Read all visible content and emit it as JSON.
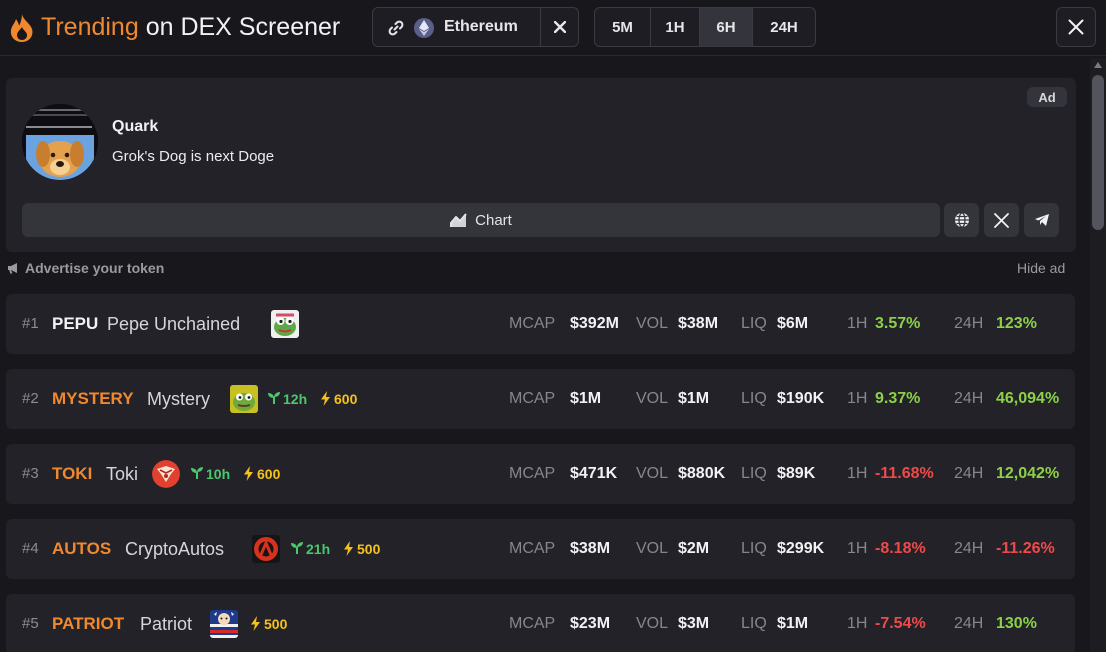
{
  "header": {
    "title_accent": "Trending",
    "title_rest": "on DEX Screener",
    "chain_name": "Ethereum",
    "timeframes": [
      "5M",
      "1H",
      "6H",
      "24H"
    ],
    "active_timeframe": "6H"
  },
  "ad": {
    "name": "Quark",
    "description": "Grok's Dog is next Doge",
    "badge": "Ad",
    "chart_label": "Chart",
    "advertise_label": "Advertise your token",
    "hide_label": "Hide ad"
  },
  "labels": {
    "mcap": "MCAP",
    "vol": "VOL",
    "liq": "LIQ",
    "h1": "1H",
    "h24": "24H"
  },
  "tokens": [
    {
      "rank": "#1",
      "symbol": "PEPU",
      "name": "Pepe Unchained",
      "age": "",
      "boost": "",
      "mcap": "$392M",
      "vol": "$38M",
      "liq": "$6M",
      "h1": "3.57%",
      "h24": "123%"
    },
    {
      "rank": "#2",
      "symbol": "MYSTERY",
      "name": "Mystery",
      "age": "12h",
      "boost": "600",
      "mcap": "$1M",
      "vol": "$1M",
      "liq": "$190K",
      "h1": "9.37%",
      "h24": "46,094%"
    },
    {
      "rank": "#3",
      "symbol": "TOKI",
      "name": "Toki",
      "age": "10h",
      "boost": "600",
      "mcap": "$471K",
      "vol": "$880K",
      "liq": "$89K",
      "h1": "-11.68%",
      "h24": "12,042%"
    },
    {
      "rank": "#4",
      "symbol": "AUTOS",
      "name": "CryptoAutos",
      "age": "21h",
      "boost": "500",
      "mcap": "$38M",
      "vol": "$2M",
      "liq": "$299K",
      "h1": "-8.18%",
      "h24": "-11.26%"
    },
    {
      "rank": "#5",
      "symbol": "PATRIOT",
      "name": "Patriot",
      "age": "",
      "boost": "500",
      "mcap": "$23M",
      "vol": "$3M",
      "liq": "$1M",
      "h1": "-7.54%",
      "h24": "130%"
    }
  ],
  "colors": {
    "accent": "#f0892e",
    "positive": "#8cd147",
    "negative": "#ef4a4a",
    "age": "#4cc76b",
    "boost": "#f4c21c"
  },
  "icons": [
    "flame-icon",
    "link-icon",
    "ethereum-icon",
    "close-icon",
    "chart-icon",
    "globe-icon",
    "x-logo-icon",
    "telegram-icon",
    "megaphone-icon",
    "sprout-icon",
    "bolt-icon"
  ]
}
